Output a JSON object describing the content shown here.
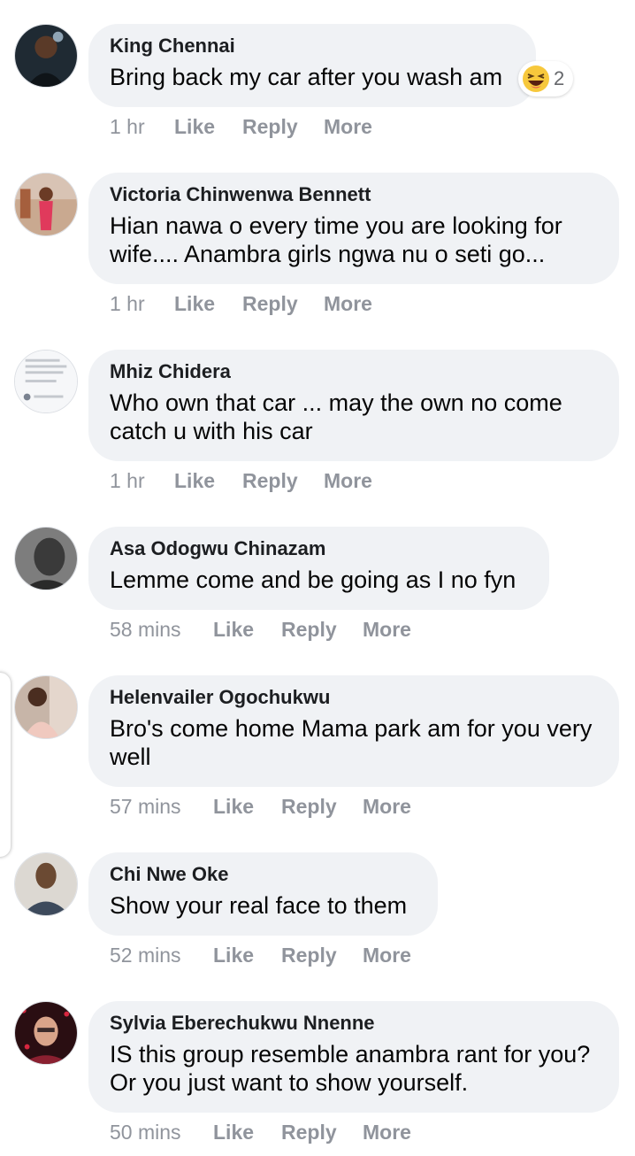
{
  "comments": [
    {
      "author": "King Chennai",
      "text": "Bring back my car after you wash am",
      "time": "1 hr",
      "like": "Like",
      "reply": "Reply",
      "more": "More",
      "reaction": {
        "icon": "laugh-emoji-icon",
        "count": "2"
      }
    },
    {
      "author": "Victoria Chinwenwa Bennett",
      "text": "Hian nawa o every time you are looking for wife.... Anambra girls ngwa nu o seti go...",
      "time": "1 hr",
      "like": "Like",
      "reply": "Reply",
      "more": "More"
    },
    {
      "author": "Mhiz Chidera",
      "text": "Who own that car ... may the own no come catch u with his car",
      "time": "1 hr",
      "like": "Like",
      "reply": "Reply",
      "more": "More"
    },
    {
      "author": "Asa Odogwu Chinazam",
      "text": "Lemme come and be going as I no fyn",
      "time": "58 mins",
      "like": "Like",
      "reply": "Reply",
      "more": "More"
    },
    {
      "author": "Helenvailer Ogochukwu",
      "text": "Bro's come home Mama park am for you very well",
      "time": "57 mins",
      "like": "Like",
      "reply": "Reply",
      "more": "More"
    },
    {
      "author": "Chi Nwe Oke",
      "text": "Show your real face to them",
      "time": "52 mins",
      "like": "Like",
      "reply": "Reply",
      "more": "More"
    },
    {
      "author": "Sylvia Eberechukwu Nnenne",
      "text": "IS this group resemble anambra rant for you? Or you just want to show yourself.",
      "time": "50 mins",
      "like": "Like",
      "reply": "Reply",
      "more": "More"
    }
  ],
  "colors": {
    "bubble": "#f0f2f5",
    "meta": "#90949c",
    "author": "#1c1e21"
  }
}
